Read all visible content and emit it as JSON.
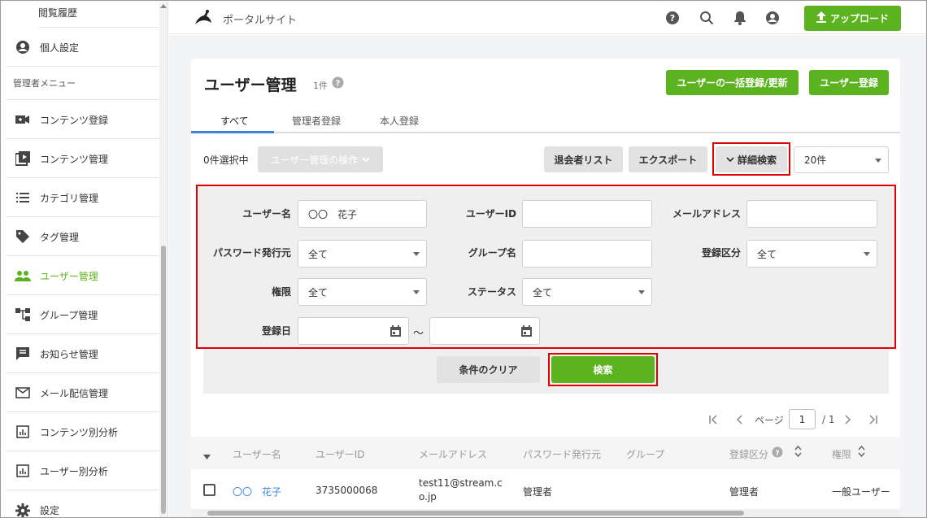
{
  "sidebar": {
    "top_item": "閲覧履歴",
    "personal": "個人設定",
    "section_label": "管理者メニュー",
    "items": [
      {
        "label": "コンテンツ登録",
        "icon": "video-add-icon"
      },
      {
        "label": "コンテンツ管理",
        "icon": "video-library-icon"
      },
      {
        "label": "カテゴリ管理",
        "icon": "list-icon"
      },
      {
        "label": "タグ管理",
        "icon": "tag-icon"
      },
      {
        "label": "ユーザー管理",
        "icon": "users-icon"
      },
      {
        "label": "グループ管理",
        "icon": "group-tree-icon"
      },
      {
        "label": "お知らせ管理",
        "icon": "announcement-icon"
      },
      {
        "label": "メール配信管理",
        "icon": "mail-icon"
      },
      {
        "label": "コンテンツ別分析",
        "icon": "bar-chart-icon"
      },
      {
        "label": "ユーザー別分析",
        "icon": "bar-chart-icon"
      },
      {
        "label": "設定",
        "icon": "gear-icon"
      }
    ],
    "active_color": "#5bb31f"
  },
  "header": {
    "site_title": "ポータルサイト",
    "upload_label": "アップロード"
  },
  "page": {
    "title": "ユーザー管理",
    "count": "1件",
    "bulk_button": "ユーザーの一括登録/更新",
    "register_button": "ユーザー登録"
  },
  "tabs": [
    "すべて",
    "管理者登録",
    "本人登録"
  ],
  "toolbar": {
    "selected": "0件選択中",
    "user_ops": "ユーザー管理の操作",
    "withdrawn_list": "退会者リスト",
    "export": "エクスポート",
    "advanced_search": "詳細検索",
    "per_page": "20件"
  },
  "search": {
    "username_label": "ユーザー名",
    "username_value": "〇〇　花子",
    "userid_label": "ユーザーID",
    "userid_value": "",
    "email_label": "メールアドレス",
    "email_value": "",
    "pw_issuer_label": "パスワード発行元",
    "pw_issuer_value": "全て",
    "group_label": "グループ名",
    "group_value": "",
    "reg_type_label": "登録区分",
    "reg_type_value": "全て",
    "permission_label": "権限",
    "permission_value": "全て",
    "status_label": "ステータス",
    "status_value": "全て",
    "reg_date_label": "登録日",
    "reg_date_from": "",
    "reg_date_to": "",
    "tilde": "～",
    "clear_button": "条件のクリア",
    "search_button": "検索"
  },
  "pagination": {
    "page_label": "ページ",
    "current": "1",
    "total": "/ 1"
  },
  "table": {
    "headers": [
      "ユーザー名",
      "ユーザーID",
      "メールアドレス",
      "パスワード発行元",
      "グループ",
      "登録区分",
      "権限"
    ],
    "rows": [
      {
        "name": "〇〇　花子",
        "id": "3735000068",
        "email_line1": "test11@stream.c",
        "email_line2": "o.jp",
        "pw_issuer": "管理者",
        "group": "",
        "reg_type": "管理者",
        "permission": "一般ユーザー"
      }
    ]
  },
  "colors": {
    "accent": "#5bb31f",
    "highlight": "#e00000",
    "link": "#3b86d8"
  }
}
